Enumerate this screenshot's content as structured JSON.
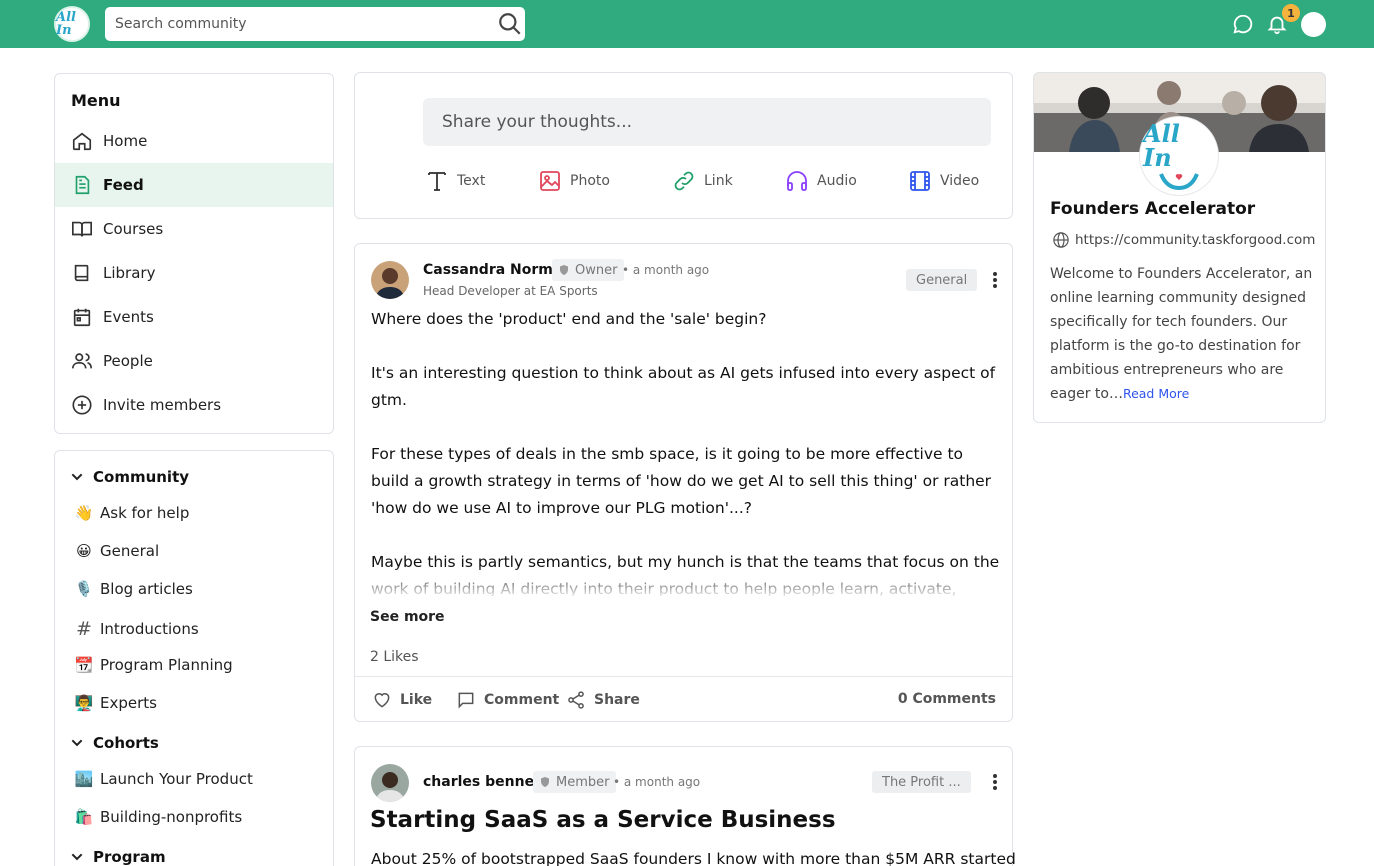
{
  "header": {
    "search_placeholder": "Search community",
    "notification_count": "1"
  },
  "menu": {
    "title": "Menu",
    "items": [
      {
        "label": "Home"
      },
      {
        "label": "Feed"
      },
      {
        "label": "Courses"
      },
      {
        "label": "Library"
      },
      {
        "label": "Events"
      },
      {
        "label": "People"
      },
      {
        "label": "Invite members"
      }
    ]
  },
  "community": {
    "groups": [
      {
        "label": "Community"
      },
      {
        "label": "Cohorts"
      },
      {
        "label": "Program"
      }
    ],
    "spaces": [
      {
        "emoji": "👋",
        "label": "Ask for help"
      },
      {
        "emoji": "😀",
        "label": "General"
      },
      {
        "emoji": "🎙️",
        "label": "Blog articles"
      },
      {
        "emoji": "#",
        "label": "Introductions"
      },
      {
        "emoji": "📆",
        "label": "Program Planning"
      },
      {
        "emoji": "👨‍🏫",
        "label": "Experts"
      },
      {
        "emoji": "🏙️",
        "label": "Launch Your Product"
      },
      {
        "emoji": "🛍️",
        "label": "Building-nonprofits"
      }
    ]
  },
  "composer": {
    "placeholder": "Share your thoughts...",
    "types": [
      {
        "label": "Text",
        "color": "#333333"
      },
      {
        "label": "Photo",
        "color": "#e0475b"
      },
      {
        "label": "Link",
        "color": "#22a06b"
      },
      {
        "label": "Audio",
        "color": "#8a3ffc"
      },
      {
        "label": "Video",
        "color": "#2f54eb"
      }
    ]
  },
  "posts": [
    {
      "author": "Cassandra Norman",
      "role": "Owner",
      "time": "• a month ago",
      "subtitle": "Head Developer at EA Sports",
      "category": "General",
      "paragraphs": [
        "Where does the 'product' end and the 'sale' begin?",
        "It's an interesting question to think about as AI gets infused into every aspect of gtm.",
        "For these types of deals in the smb space, is it going to be more effective to build a growth strategy in terms of 'how do we get AI to sell this thing' or rather 'how do we use AI to improve our PLG motion'...?",
        "Maybe this is partly semantics, but my hunch is that the teams that focus on the work of building AI directly into their product to help people learn, activate, shorten time-to-value, etc. are going to be more successful than those trying to bolt on an AI sales"
      ],
      "see_more": "See more",
      "likes": "2 Likes",
      "actions": {
        "like": "Like",
        "comment": "Comment",
        "share": "Share"
      },
      "comments": "0 Comments"
    },
    {
      "author": "charles bennett",
      "role": "Member",
      "time": "• a month ago",
      "category": "The Profit ...",
      "title": "Starting SaaS as a Service Business",
      "excerpt": "About 25% of bootstrapped SaaS founders I know with more than $5M ARR started"
    }
  ],
  "about": {
    "title": "Founders Accelerator",
    "url": "https://community.taskforgood.com",
    "description": "Welcome to Founders Accelerator, an online learning community designed specifically for tech founders. Our platform is the go-to destination for ambitious entrepreneurs who are eager to…",
    "read_more": "Read More"
  },
  "brand": {
    "primary": "#2fab7f",
    "logo_text": "All In"
  }
}
